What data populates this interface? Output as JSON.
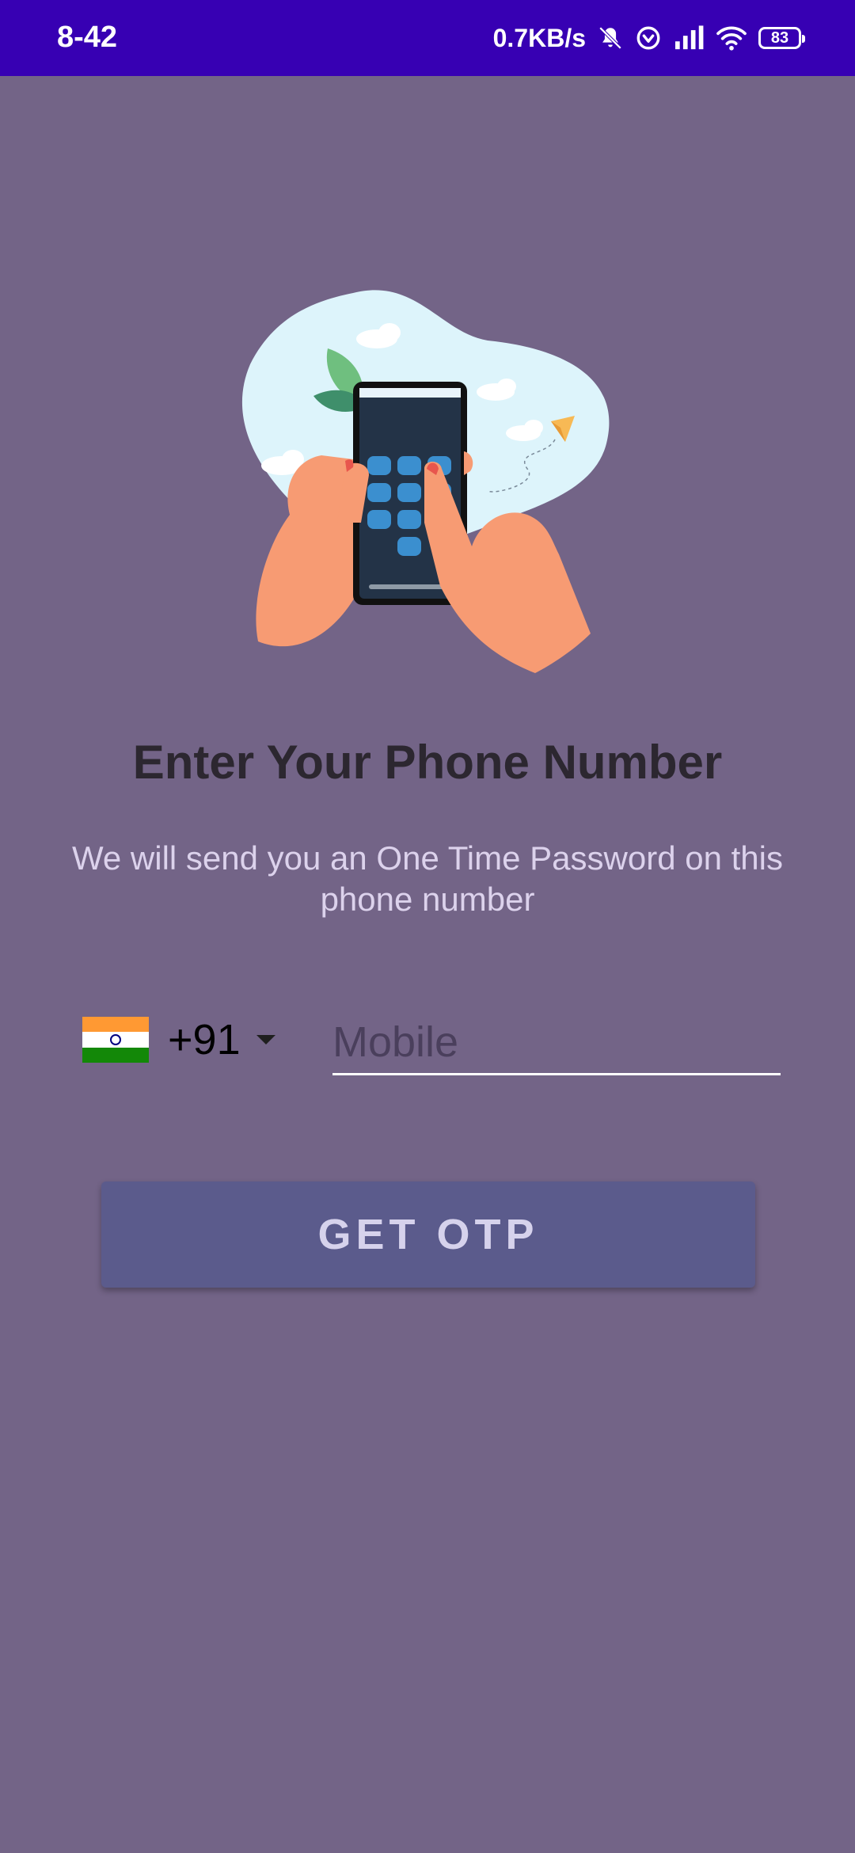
{
  "status_bar": {
    "time": "8-42",
    "net_speed": "0.7KB/s",
    "battery": "83",
    "icons": [
      "mute-icon",
      "vpn-icon",
      "signal-icon",
      "wifi-icon",
      "battery-icon"
    ]
  },
  "illustration": {
    "icon": "hand-holding-phone-illustration"
  },
  "heading": "Enter Your Phone Number",
  "subtitle": "We will send you an One Time Password on this phone number",
  "country_picker": {
    "flag": "india-flag-icon",
    "dial_code": "+91"
  },
  "mobile_input": {
    "value": "",
    "placeholder": "Mobile"
  },
  "otp_button": {
    "label": "GET OTP"
  },
  "colors": {
    "status_bar": "#3700b3",
    "background": "#736487",
    "button": "#5b5b8c",
    "heading": "#2c2730",
    "subtitle": "#dcd2ec"
  }
}
